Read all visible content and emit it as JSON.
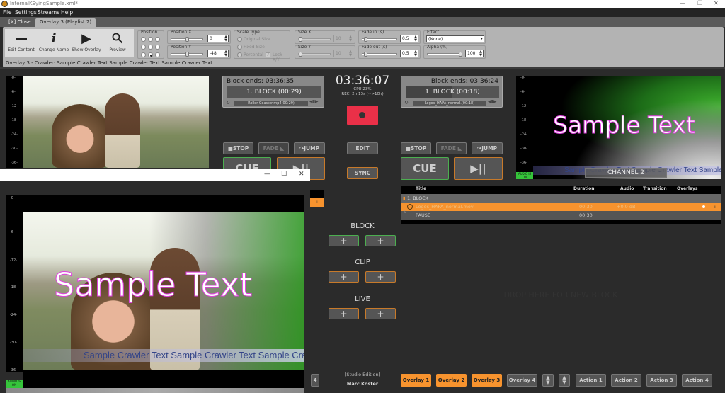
{
  "window": {
    "title": "InternalKEyingSample.xml*",
    "controls": [
      "—",
      "❐",
      "✕"
    ]
  },
  "menu": [
    "File",
    "Settings",
    "Streams",
    "Help"
  ],
  "tabs": [
    {
      "label": "[X] Close"
    },
    {
      "label": "Overlay 3 (Playlist 2)",
      "active": true
    }
  ],
  "ribbon": {
    "tools": [
      {
        "label": "Edit Content",
        "icon": "minus-icon"
      },
      {
        "label": "Change Name",
        "icon": "info-icon"
      },
      {
        "label": "Show Overlay",
        "icon": "play-icon"
      },
      {
        "label": "Preview",
        "icon": "search-icon"
      }
    ],
    "position": {
      "label": "Position",
      "selected": "bottom-center"
    },
    "position_x": {
      "label": "Position X",
      "value": "0"
    },
    "position_y": {
      "label": "Position Y",
      "value": "-48"
    },
    "scale_type": {
      "label": "Scale Type",
      "options": [
        "Original Size",
        "Fixed Size",
        "Percental"
      ],
      "lock": "Lock X/Y"
    },
    "size_x": {
      "label": "Size X",
      "value": "10"
    },
    "size_y": {
      "label": "Size Y",
      "value": "10"
    },
    "fade_in": {
      "label": "Fade in (s)",
      "value": "0,5"
    },
    "fade_out": {
      "label": "Fade out (s)",
      "value": "0,5"
    },
    "effect": {
      "label": "Effect",
      "value": "(None)"
    },
    "alpha": {
      "label": "Alpha (%)",
      "value": "100"
    },
    "status": "Overlay 3 -  Crawler: Sample Crawler Text Sample Crawler Text Sample Crawler Text"
  },
  "player1": {
    "block_ends": "Block ends: 03:36:35",
    "block": "1. BLOCK (00:29)",
    "clip": "Roller Coaster.mp4(00:29)"
  },
  "player2": {
    "block_ends": "Block ends: 03:36:24",
    "block": "1. BLOCK (00:18)",
    "clip": "Logos_HAPA_normal.(00:18)"
  },
  "transport": {
    "stop": "■STOP",
    "fade": "FADE ◣",
    "jump": "↷JUMP",
    "cue": "CUE",
    "play": "▶||"
  },
  "center": {
    "clock": "03:36:07",
    "cpu": "CPU:23%",
    "rec": "REC: 2m13s (~>10h)",
    "edit": "EDIT",
    "sync": "SYNC",
    "block": "BLOCK",
    "clip": "CLIP",
    "live": "LIVE",
    "plus": "+",
    "edition": "[Studio Edition]",
    "user": "Marc Köster"
  },
  "meter_ticks": [
    "-0-",
    "-6-",
    "-12-",
    "-18-",
    "-24-",
    "-30-",
    "-36-"
  ],
  "audio_badge": "AUDIO IS ON",
  "channel2": {
    "label": "CHANNEL 2"
  },
  "overlay_text": "Sample Text",
  "crawler_text": "Sample Crawler Text Sample Crawler Text Sample Crawler Text Sample Crawler Text",
  "playlist": {
    "columns": [
      "Title",
      "Duration",
      "Audio",
      "Transition",
      "Overlays"
    ],
    "rows": [
      {
        "title": "1. BLOCK",
        "type": "block"
      },
      {
        "title": "Logos_HAPA_normal.mov",
        "duration": "00:30",
        "audio": "+0,0 dB",
        "type": "active",
        "info": "i"
      },
      {
        "title": "PAUSE",
        "duration": "00:30",
        "type": "pause"
      }
    ],
    "drop_hint": "DROP HERE FOR NEW BLOCK"
  },
  "bottom": {
    "overlays": [
      {
        "label": "Overlay 1",
        "active": true
      },
      {
        "label": "Overlay 2",
        "active": true
      },
      {
        "label": "Overlay 3",
        "active": true
      },
      {
        "label": "Overlay 4",
        "active": false
      }
    ],
    "actions": [
      "Action 1",
      "Action 2",
      "Action 3",
      "Action 4"
    ],
    "left_partial": "4"
  },
  "preview_window": {
    "controls": [
      "—",
      "☐",
      "✕"
    ]
  }
}
